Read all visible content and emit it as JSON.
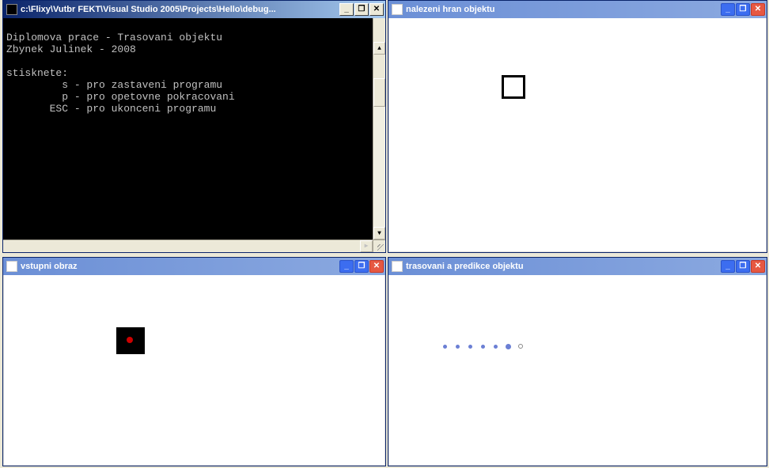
{
  "windows": {
    "console": {
      "title": "c:\\Flixy\\Vutbr FEKT\\Visual Studio 2005\\Projects\\Hello\\debug...",
      "lines": [
        "Diplomova prace - Trasovani objektu",
        "Zbynek Julinek - 2008",
        "",
        "stisknete:",
        "         s - pro zastaveni programu",
        "         p - pro opetovne pokracovani",
        "       ESC - pro ukonceni programu"
      ]
    },
    "edges": {
      "title": "nalezeni hran objektu"
    },
    "input": {
      "title": "vstupni obraz"
    },
    "track": {
      "title": "trasovani a predikce objektu"
    }
  },
  "controls": {
    "minimize": "_",
    "maximize": "❐",
    "close": "✕",
    "up": "▲",
    "down": "▼",
    "left": "◀",
    "right": "▶"
  }
}
